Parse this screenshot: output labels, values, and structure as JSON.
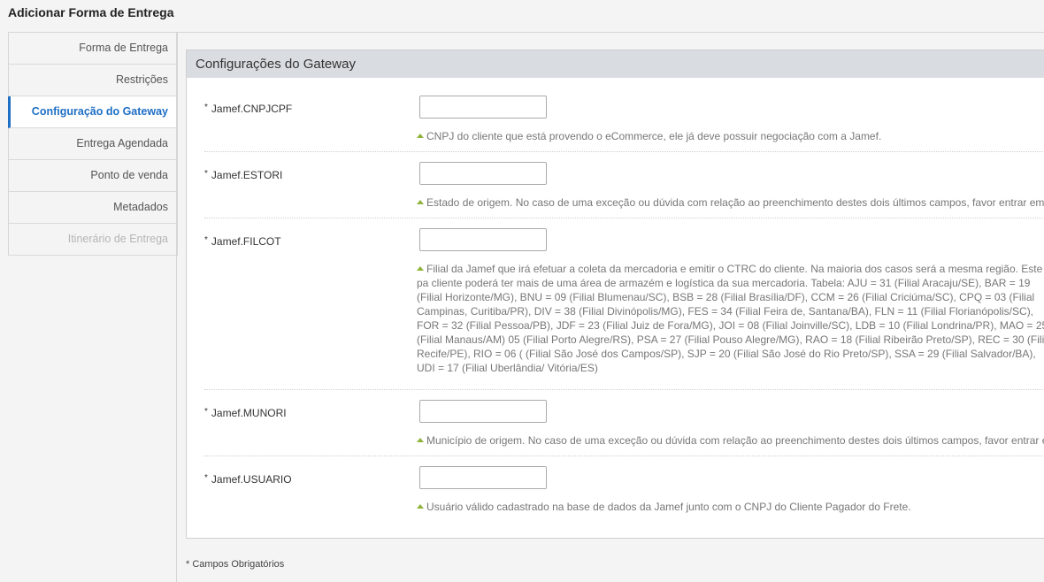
{
  "page_title": "Adicionar Forma de Entrega",
  "sidebar": {
    "items": [
      {
        "label": "Forma de Entrega",
        "state": "normal"
      },
      {
        "label": "Restrições",
        "state": "normal"
      },
      {
        "label": "Configuração do Gateway",
        "state": "active"
      },
      {
        "label": "Entrega Agendada",
        "state": "normal"
      },
      {
        "label": "Ponto de venda",
        "state": "normal"
      },
      {
        "label": "Metadados",
        "state": "normal"
      },
      {
        "label": "Itinerário de Entrega",
        "state": "disabled"
      }
    ]
  },
  "panel": {
    "title": "Configurações do Gateway",
    "required_marker": "*",
    "fields": [
      {
        "label": "Jamef.CNPJCPF",
        "value": "",
        "help": "CNPJ do cliente que está provendo o eCommerce, ele já deve possuir negociação com a Jamef."
      },
      {
        "label": "Jamef.ESTORI",
        "value": "",
        "help": "Estado de origem. No caso de uma exceção ou dúvida com relação ao preenchimento destes dois últimos campos, favor entrar em"
      },
      {
        "label": "Jamef.FILCOT",
        "value": "",
        "help": "Filial da Jamef que irá efetuar a coleta da mercadoria e emitir o CTRC do cliente. Na maioria dos casos será a mesma região. Este pa cliente poderá ter mais de uma área de armazém e logística da sua mercadoria. Tabela: AJU = 31 (Filial Aracaju/SE), BAR = 19 (Filial Horizonte/MG), BNU = 09 (Filial Blumenau/SC), BSB = 28 (Filial Brasília/DF), CCM = 26 (Filial Criciúma/SC), CPQ = 03 (Filial Campinas, Curitiba/PR), DIV = 38 (Filial Divinópolis/MG), FES = 34 (Filial Feira de, Santana/BA), FLN = 11 (Filial Florianópolis/SC), FOR = 32 (Filial Pessoa/PB), JDF = 23 (Filial Juiz de Fora/MG), JOI = 08 (Filial Joinville/SC), LDB = 10 (Filial Londrina/PR), MAO = 25 (Filial Manaus/AM) 05 (Filial Porto Alegre/RS), PSA = 27 (Filial Pouso Alegre/MG), RAO = 18 (Filial Ribeirão Preto/SP), REC = 30 (Filial Recife/PE), RIO = 06 ( (Filial São José dos Campos/SP), SJP = 20 (Filial São José do Rio Preto/SP), SSA = 29 (Filial Salvador/BA), UDI = 17 (Filial Uberlândia/ Vitória/ES)"
      },
      {
        "label": "Jamef.MUNORI",
        "value": "",
        "help": "Município de origem. No caso de uma exceção ou dúvida com relação ao preenchimento destes dois últimos campos, favor entrar e"
      },
      {
        "label": "Jamef.USUARIO",
        "value": "",
        "help": "Usuário válido cadastrado na base de dados da Jamef junto com o CNPJ do Cliente Pagador do Frete."
      }
    ]
  },
  "footnote": "* Campos Obrigatórios"
}
